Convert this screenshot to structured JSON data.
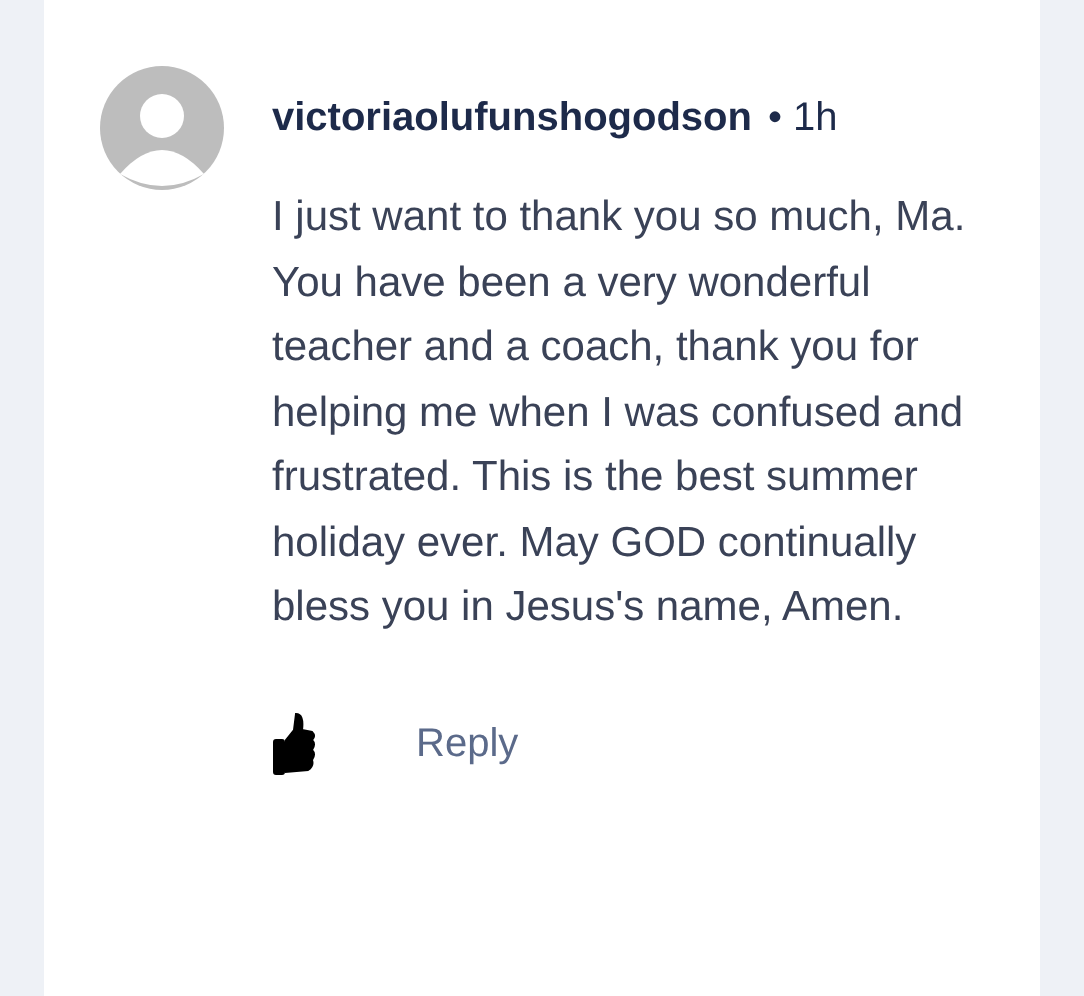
{
  "comment": {
    "author": "victoriaolufunshogodson",
    "separator": "•",
    "time": "1h",
    "body": "I just want to thank you so much, Ma. You have been a very wonderful teacher and a coach, thank you for helping me when I was confused and frustrated. This is the best summer holiday ever. May GOD continually bless you in Jesus's name, Amen.",
    "liked": true,
    "reply_label": "Reply"
  }
}
